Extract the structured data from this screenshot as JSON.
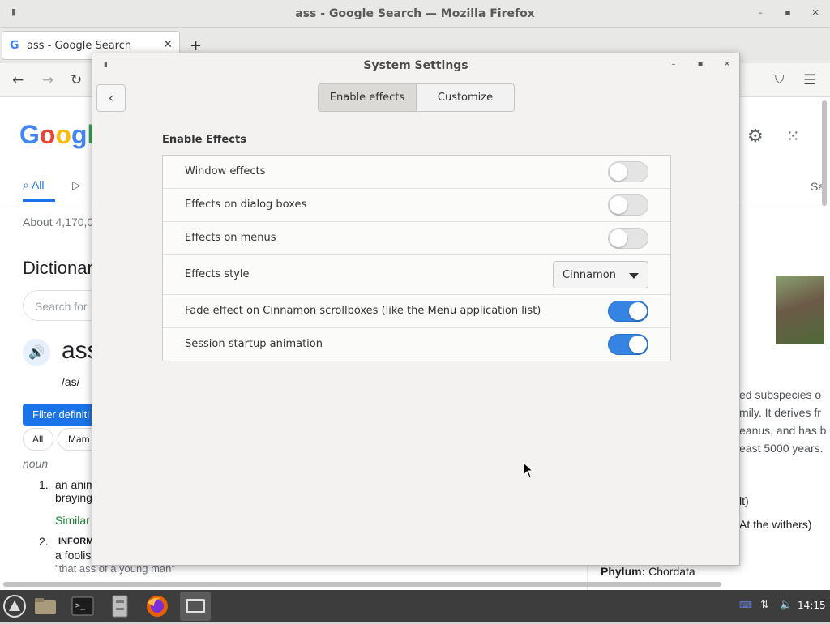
{
  "firefox": {
    "window_title": "ass - Google Search — Mozilla Firefox",
    "tab_title": "ass - Google Search",
    "tab_favicon": "G"
  },
  "google_page": {
    "logo": "Google",
    "tab_all": "All",
    "results_count": "About 4,170,0",
    "dictionary_heading": "Dictionar",
    "search_placeholder": "Search for",
    "word": "ass",
    "phonetic": "/as/",
    "filter_button": "Filter definiti",
    "chip_all": "All",
    "chip_mam": "Mam",
    "pos": "noun",
    "def1_num": "1.",
    "def1_line1": "an anim",
    "def1_line2": "braying",
    "similar": "Similar",
    "def2_num": "2.",
    "def2_label": "INFORM",
    "def2_line1": "a foolis",
    "def2_example": "\"that ass of a young man\"",
    "right_text_1": "ed subspecies o",
    "right_text_2": "mily. It derives fr",
    "right_text_3": "eanus, and has b",
    "right_text_4": "east 5000 years.",
    "right_text_5": "lt)",
    "right_text_6": "At the withers)",
    "phylum_label": "Phylum:",
    "phylum_value": "Chordata",
    "sa_tab": "Sa"
  },
  "dialog": {
    "title": "System Settings",
    "tabs": [
      {
        "label": "Enable effects",
        "active": true
      },
      {
        "label": "Customize",
        "active": false
      }
    ],
    "section_title": "Enable Effects",
    "rows": [
      {
        "label": "Window effects",
        "control": "switch",
        "on": false
      },
      {
        "label": "Effects on dialog boxes",
        "control": "switch",
        "on": false
      },
      {
        "label": "Effects on menus",
        "control": "switch",
        "on": false
      },
      {
        "label": "Effects style",
        "control": "select",
        "value": "Cinnamon"
      },
      {
        "label": "Fade effect on Cinnamon scrollboxes (like the Menu application list)",
        "control": "switch",
        "on": true
      },
      {
        "label": "Session startup animation",
        "control": "switch",
        "on": true
      }
    ]
  },
  "taskbar": {
    "clock": "14:15",
    "items": [
      "menu-icon",
      "files-icon",
      "terminal-icon",
      "file-manager-icon",
      "firefox-icon",
      "system-settings-icon"
    ]
  },
  "colors": {
    "switch_on": "#3584e4",
    "google_blue": "#1a73e8"
  }
}
